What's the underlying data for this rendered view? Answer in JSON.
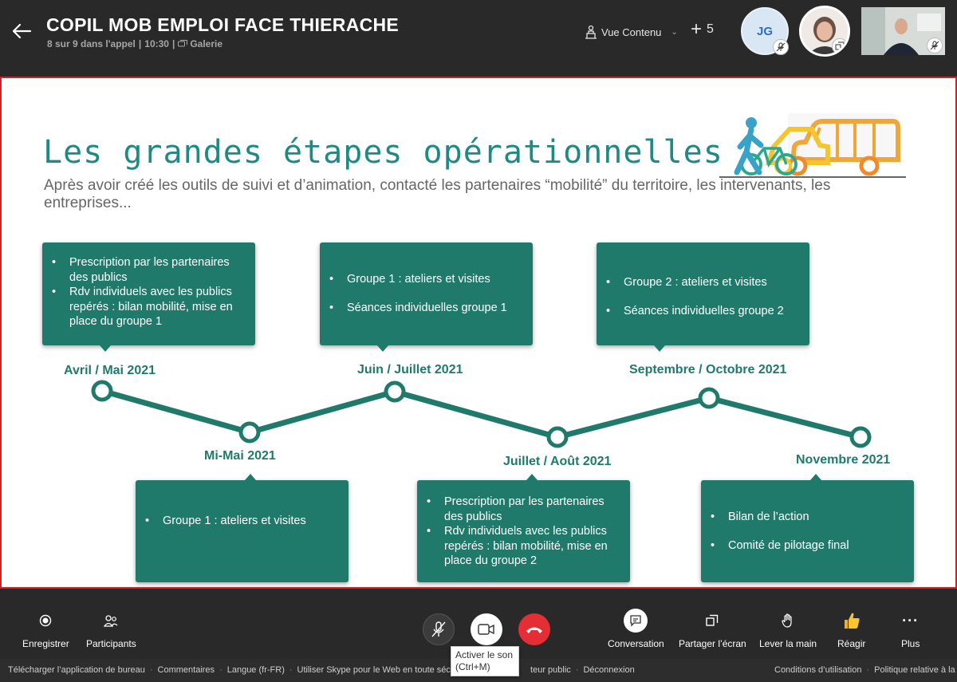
{
  "header": {
    "title": "COPIL MOB EMPLOI FACE THIERACHE",
    "call_info": "8 sur 9 dans l'appel",
    "time": "10:30",
    "layout": "Galerie",
    "view_content_label": "Vue Contenu",
    "more_participants": "5",
    "participants": [
      {
        "initials": "JG",
        "muted": true
      },
      {
        "initials": "",
        "muted": false
      },
      {
        "initials": "",
        "muted": true
      }
    ]
  },
  "slide": {
    "title": "Les grandes étapes opérationnelles",
    "intro": "Après avoir créé les outils de suivi et d’animation, contacté les partenaires “mobilité” du territoire, les intervenants, les entreprises...",
    "accent_color": "#1f7a6c",
    "timeline": [
      {
        "date": "Avril / Mai 2021",
        "items": [
          "Prescription par les partenaires des publics",
          "Rdv individuels avec les publics repérés : bilan mobilité, mise en place du groupe 1"
        ]
      },
      {
        "date": "Mi-Mai 2021",
        "items": [
          "Groupe 1 : ateliers et visites"
        ]
      },
      {
        "date": "Juin / Juillet 2021",
        "items": [
          "Groupe 1 : ateliers et visites",
          "Séances individuelles groupe 1"
        ]
      },
      {
        "date": "Juillet / Août 2021",
        "items": [
          "Prescription par les partenaires des publics",
          "Rdv individuels avec les publics repérés : bilan mobilité, mise en place du groupe 2"
        ]
      },
      {
        "date": "Septembre / Octobre 2021",
        "items": [
          "Groupe 2 : ateliers et visites",
          "Séances individuelles groupe 2"
        ]
      },
      {
        "date": "Novembre 2021",
        "items": [
          "Bilan de l’action",
          "Comité de pilotage final"
        ]
      }
    ]
  },
  "controls": {
    "record": "Enregistrer",
    "participants": "Participants",
    "conversation": "Conversation",
    "share_screen": "Partager l’écran",
    "raise_hand": "Lever la main",
    "react": "Réagir",
    "more": "Plus",
    "tooltip_line1": "Activer le son",
    "tooltip_line2": "(Ctrl+M)",
    "hangup_color": "#e52d34"
  },
  "footer": {
    "links": [
      "Télécharger l’application de bureau",
      "Commentaires",
      "Langue (fr-FR)",
      "Utiliser Skype pour le Web en toute sécu",
      "teur public",
      "Déconnexion"
    ],
    "right_links": [
      "Conditions d’utilisation",
      "Politique relative à la"
    ]
  }
}
